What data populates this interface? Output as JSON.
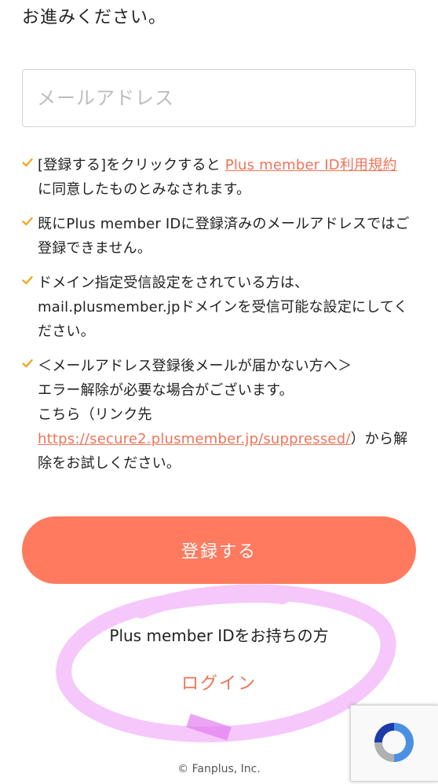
{
  "intro_text": "お進みください。",
  "email": {
    "placeholder": "メールアドレス",
    "value": ""
  },
  "notes": [
    {
      "before": "[登録する]をクリックすると ",
      "link": "Plus member ID利用規約",
      "after": "に同意したものとみなされます。"
    },
    {
      "text": "既にPlus member IDに登録済みのメールアドレスではご登録できません。"
    },
    {
      "text": "ドメイン指定受信設定をされている方は、mail.plusmember.jpドメインを受信可能な設定にしてください。"
    },
    {
      "line1": "＜メールアドレス登録後メールが届かない方へ＞",
      "line2": "エラー解除が必要な場合がございます。",
      "line3": "こちら（リンク先",
      "link": "https://secure2.plusmember.jp/suppressed/",
      "after": "）から解除をお試しください。"
    }
  ],
  "register_button": "登録する",
  "have_id_text": "Plus member IDをお持ちの方",
  "login_link": "ログイン",
  "footer": "© Fanplus, Inc.",
  "icons": {
    "check": "check-icon",
    "recaptcha": "recaptcha-icon"
  },
  "colors": {
    "accent": "#ff7a5f",
    "link": "#f07358",
    "check": "#f5a623",
    "scribble": "#ee99f5"
  }
}
